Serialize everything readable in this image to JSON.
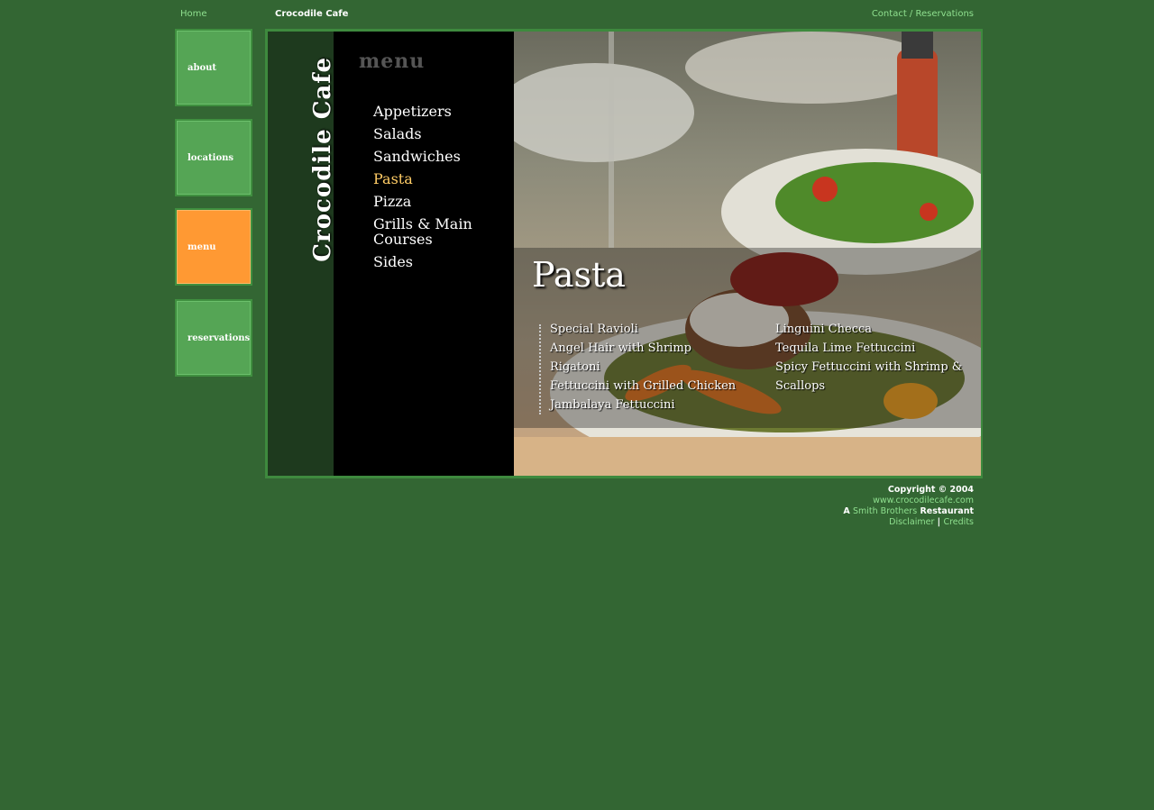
{
  "top_bar": {
    "home": "Home",
    "site_name": "Crocodile Cafe",
    "contact": "Contact / Reservations"
  },
  "nav": [
    {
      "label": "about",
      "active": false
    },
    {
      "label": "locations",
      "active": false
    },
    {
      "label": "menu",
      "active": true
    },
    {
      "label": "reservations",
      "active": false
    }
  ],
  "brand": "Crocodile Cafe",
  "menu": {
    "heading": "menu",
    "items": [
      "Appetizers",
      "Salads",
      "Sandwiches",
      "Pasta",
      "Pizza",
      "Grills & Main Courses",
      "Sides"
    ],
    "active_item": "Pasta"
  },
  "section": {
    "title": "Pasta",
    "dishes_left": [
      "Special Ravioli",
      "Angel Hair with Shrimp",
      "Rigatoni",
      "Fettuccini with Grilled Chicken",
      "Jambalaya Fettuccini"
    ],
    "dishes_right": [
      "Linguini Checca",
      "Tequila Lime Fettuccini",
      "Spicy Fettuccini with Shrimp & Scallops"
    ]
  },
  "footer": {
    "copyright": "Copyright © 2004",
    "url": "www.crocodilecafe.com",
    "restaurant_prefix": "A",
    "restaurant_link": "Smith Brothers",
    "restaurant_suffix": "Restaurant",
    "disclaimer": "Disclaimer",
    "separator": "|",
    "credits": "Credits"
  },
  "colors": {
    "background": "#336633",
    "nav_green": "#55a555",
    "nav_active": "#ff9933",
    "link_green": "#8fe08f",
    "active_menu": "#ffcc66"
  }
}
